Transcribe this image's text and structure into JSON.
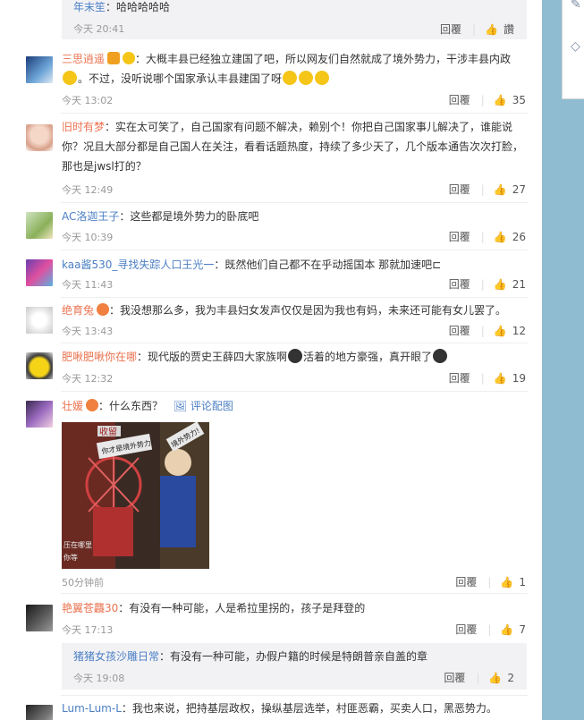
{
  "top_reply": {
    "user": "年末笙",
    "text": "：哈哈哈哈哈",
    "time": "今天 20:41",
    "reply": "回覆",
    "like": "讚"
  },
  "comments": [
    {
      "user": "三思逍遥",
      "text": "：大概丰县已经独立建国了吧，所以网友们自然就成了境外势力，干涉丰县内政",
      "text2": "。不过，没听说哪个国家承认丰县建国了呀",
      "time": "今天 13:02",
      "reply": "回覆",
      "likes": "35"
    },
    {
      "user": "旧时有梦",
      "text": "：实在太可笑了，自己国家有问题不解决，赖别个！你把自己国家事儿解决了，谁能说你？况且大部分都是自己国人在关注，看看话题热度，持续了多少天了，几个版本通告次次打脸，那也是jwsl打的？",
      "time": "今天 12:49",
      "reply": "回覆",
      "likes": "27"
    },
    {
      "user": "AC洛迦王子",
      "text": "：这些都是境外势力的卧底吧",
      "time": "今天 10:39",
      "reply": "回覆",
      "likes": "26"
    },
    {
      "user": "kaa酱530_寻找失踪人口王光一",
      "text": "：既然他们自己都不在乎动摇国本 那就加速吧⊏",
      "time": "今天 11:43",
      "reply": "回覆",
      "likes": "21"
    },
    {
      "user": "绝育兔",
      "text": "：我没想那么多，我为丰县妇女发声仅仅是因为我也有妈，未来还可能有女儿罢了。",
      "time": "今天 13:43",
      "reply": "回覆",
      "likes": "12"
    },
    {
      "user": "肥啾肥啾你在哪",
      "text": "：现代版的贾史王薛四大家族啊",
      "text2": "活着的地方豪强，真开眼了",
      "time": "今天 12:32",
      "reply": "回覆",
      "likes": "19"
    },
    {
      "user": "壮媛",
      "text": "：什么东西？",
      "pic_link": "评论配图",
      "time": "50分钟前",
      "reply": "回覆",
      "likes": "1"
    },
    {
      "user": "艳翼苍龘30",
      "text": "：有没有一种可能，人是希拉里拐的，孩子是拜登的",
      "time": "今天 17:13",
      "reply": "回覆",
      "likes": "7"
    },
    {
      "user": "Lum-Lum-L",
      "text": "：我也来说，把持基层政权，操纵基层选举，村匪恶霸，买卖人口，黑恶势力。"
    }
  ],
  "nested_reply": {
    "user": "猪猪女孩沙雕日常",
    "text": "：有没有一种可能，办假户籍的时候是特朗普亲自盖的章",
    "time": "今天 19:08",
    "reply": "回覆",
    "likes": "2"
  },
  "image_texts": [
    "收留",
    "你才是境外势力!",
    "境外势力!",
    "压在哪里",
    "你等"
  ],
  "icons": {
    "like": "thumbs-up-icon",
    "edit": "pencil-icon",
    "share": "tag-icon"
  }
}
